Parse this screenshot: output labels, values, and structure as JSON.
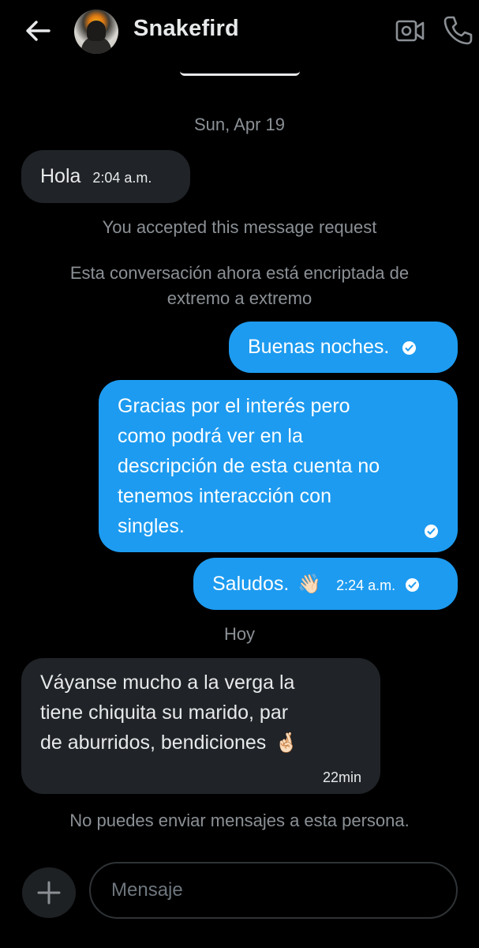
{
  "header": {
    "back_icon": "arrow-left-icon",
    "username": "Snakefird",
    "video_icon": "video-call-icon",
    "phone_icon": "phone-call-icon"
  },
  "conversation": {
    "date_1": "Sun, Apr 19",
    "msg_1": {
      "text": "Hola",
      "time": "2:04 a.m.",
      "direction": "received"
    },
    "system_1": "You accepted this message request",
    "system_2_line1": "Esta conversación ahora está encriptada de",
    "system_2_line2": "extremo a extremo",
    "msg_2": {
      "text": "Buenas noches.",
      "direction": "sent"
    },
    "msg_3": {
      "lines": [
        "Gracias por el interés pero",
        "como podrá ver en la",
        "descripción de esta cuenta no",
        "tenemos interacción con",
        "singles."
      ],
      "direction": "sent"
    },
    "msg_4": {
      "text": "Saludos.",
      "emoji": "👋🏻",
      "time": "2:24 a.m.",
      "direction": "sent"
    },
    "date_2": "Hoy",
    "msg_5": {
      "lines": [
        "Váyanse mucho a la verga la",
        "tiene chiquita su marido, par",
        "de aburridos, bendiciones"
      ],
      "emoji": "🤞🏻",
      "time": "22min",
      "direction": "received"
    },
    "blocked_notice": "No puedes enviar mensajes a esta persona."
  },
  "composer": {
    "add_icon": "plus-icon",
    "placeholder": "Mensaje"
  },
  "colors": {
    "background": "#000000",
    "sent_bubble": "#1d9bf0",
    "received_bubble": "#202327",
    "secondary_text": "#8b9095"
  }
}
